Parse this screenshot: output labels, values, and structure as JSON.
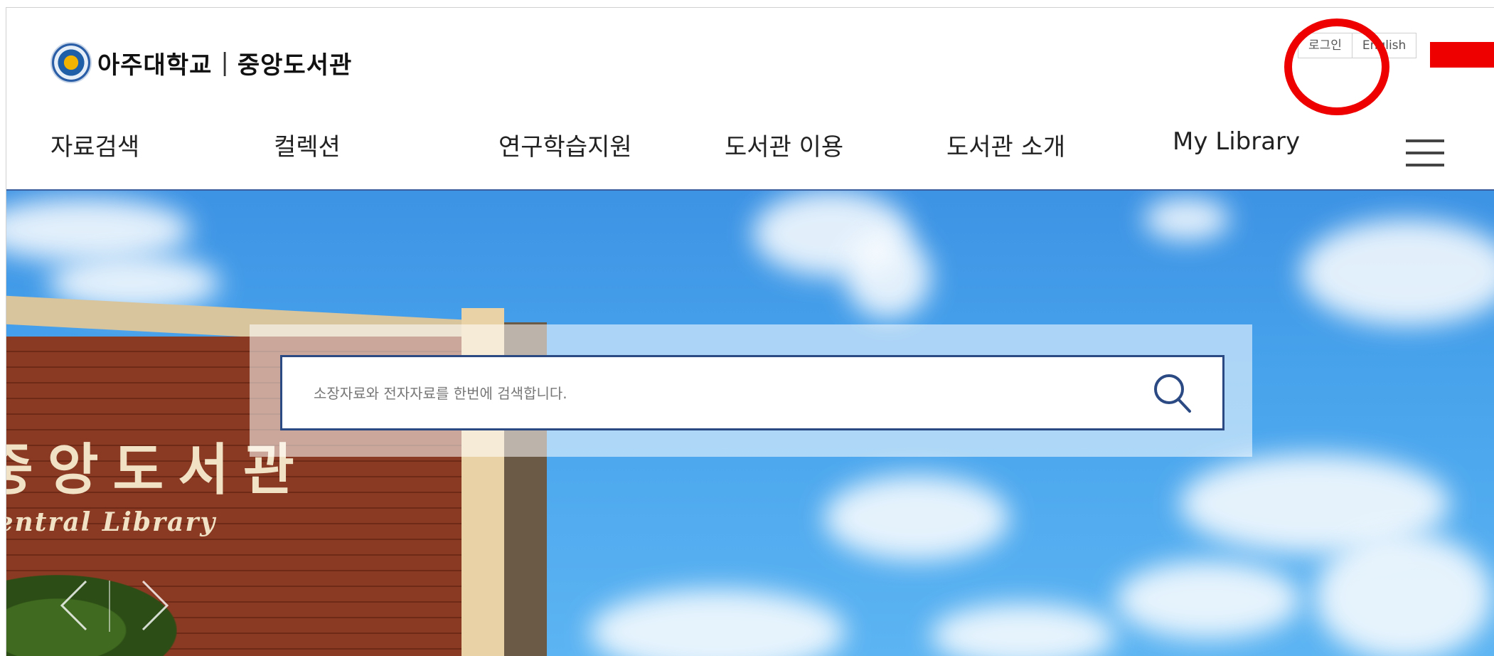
{
  "header": {
    "logo_primary": "아주대학교",
    "logo_separator": "|",
    "logo_secondary": "중앙도서관",
    "util": {
      "login_label": "로그인",
      "english_label": "English"
    }
  },
  "nav": {
    "items": [
      {
        "label": "자료검색"
      },
      {
        "label": "컬렉션"
      },
      {
        "label": "연구학습지원"
      },
      {
        "label": "도서관 이용"
      },
      {
        "label": "도서관 소개"
      },
      {
        "label": "My Library"
      }
    ],
    "menu_icon": "hamburger-icon"
  },
  "hero": {
    "building_sign_kr": "중앙도서관",
    "building_sign_en": "Central Library",
    "search": {
      "placeholder": "소장자료와 전자자료를 한번에 검색합니다.",
      "button_icon": "search-icon"
    },
    "slider": {
      "prev_icon": "chevron-left-icon",
      "next_icon": "chevron-right-icon"
    }
  },
  "annotation": {
    "highlight_color": "#ee0000"
  },
  "colors": {
    "search_border": "#2b4a84",
    "nav_underline": "#3b5f9e",
    "sky": "#48a3ec"
  }
}
